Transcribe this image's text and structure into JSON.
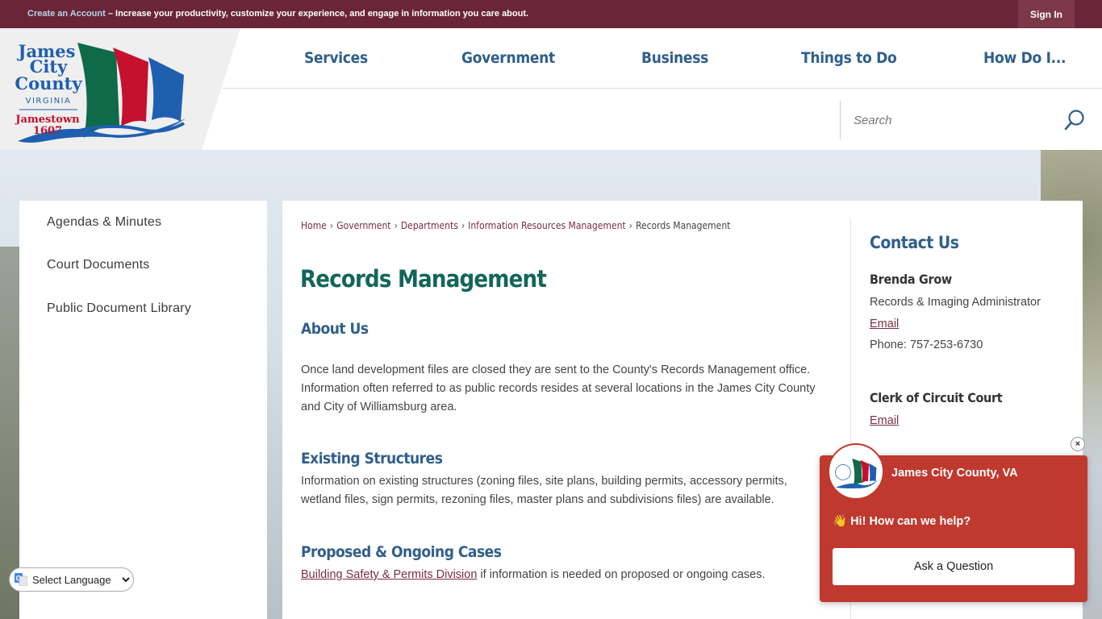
{
  "topbar": {
    "create_account": "Create an Account",
    "message": " – Increase your productivity, customize your experience, and engage in information you care about.",
    "sign_in": "Sign In"
  },
  "logo": {
    "line1": "James",
    "line2": "City",
    "line3": "County",
    "line4": "VIRGINIA",
    "line5": "Jamestown",
    "line6": "1607"
  },
  "nav": {
    "items": [
      {
        "label": "Services"
      },
      {
        "label": "Government"
      },
      {
        "label": "Business"
      },
      {
        "label": "Things to Do"
      },
      {
        "label": "How Do I..."
      }
    ]
  },
  "search": {
    "placeholder": "Search",
    "icon": "search-icon"
  },
  "sidebar": {
    "items": [
      {
        "label": "Agendas & Minutes"
      },
      {
        "label": "Court Documents"
      },
      {
        "label": "Public Document Library"
      }
    ]
  },
  "breadcrumb": {
    "items": [
      "Home",
      "Government",
      "Departments",
      "Information Resources Management"
    ],
    "current": "Records Management",
    "separator": "›"
  },
  "main": {
    "title": "Records Management",
    "sections": [
      {
        "heading": "About Us",
        "line1": "Once land development files are closed they are sent to the County's Records Management office.",
        "line2": "Information often referred to as public records resides at several locations in the James City County",
        "line3": "and City of Williamsburg area."
      },
      {
        "heading": "Existing Structures",
        "line1": "Information on existing structures (zoning files, site plans, building permits, accessory permits,",
        "line2": "wetland files, sign permits, rezoning files, master plans and subdivisions files) are available."
      },
      {
        "heading": "Proposed & Ongoing Cases",
        "link": "Building Safety & Permits Division",
        "text": " if information is needed on proposed or ongoing cases."
      }
    ]
  },
  "contact": {
    "title": "Contact Us",
    "person_name": "Brenda Grow",
    "person_role": "Records & Imaging Administrator",
    "person_email": "Email",
    "person_phone": "Phone: 757-253-6730",
    "office_name": "Clerk of Circuit Court",
    "office_email": "Email"
  },
  "language": {
    "selected": "Select Language"
  },
  "chat": {
    "org": "James City County, VA",
    "greeting": "👋 Hi! How can we help?",
    "button": "Ask a Question",
    "close": "×"
  },
  "colors": {
    "topbar": "#6b2538",
    "nav_text": "#2f5f8b",
    "title": "#12665a",
    "link": "#7a2d42",
    "chat": "#c0392f"
  }
}
